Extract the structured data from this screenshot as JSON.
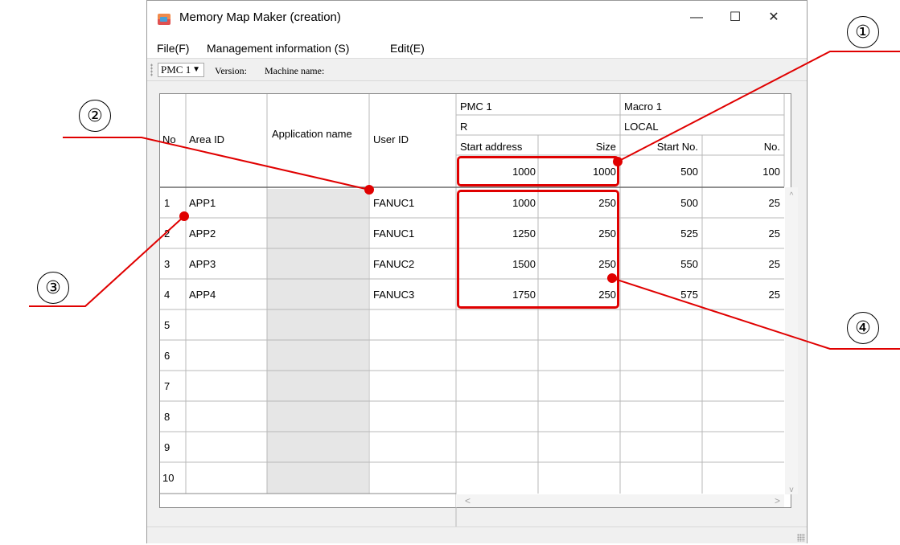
{
  "window": {
    "title": "Memory Map Maker (creation)",
    "minimize": "—",
    "maximize": "☐",
    "close": "✕"
  },
  "menu": [
    "File(F)",
    "Management information (S)",
    "Edit(E)"
  ],
  "toolbar": {
    "pmc_select": "PMC 1",
    "version_label": "Version:",
    "machine_label": "Machine name:"
  },
  "table": {
    "headers": {
      "no": "No",
      "area_id": "Area ID",
      "app_name": "Application name",
      "user_id": "User ID"
    },
    "groups": [
      {
        "name": "PMC 1",
        "sub": "R",
        "col1": "Start address",
        "col2": "Size",
        "val1": "1000",
        "val2": "1000"
      },
      {
        "name": "Macro 1",
        "sub": "LOCAL",
        "col1": "Start No.",
        "col2": "No.",
        "val1": "500",
        "val2": "100"
      }
    ],
    "rows": [
      {
        "no": "1",
        "area_id": "APP1",
        "user_id": "FANUC1",
        "pmc_start": "1000",
        "pmc_size": "250",
        "macro_start": "500",
        "macro_no": "25"
      },
      {
        "no": "2",
        "area_id": "APP2",
        "user_id": "FANUC1",
        "pmc_start": "1250",
        "pmc_size": "250",
        "macro_start": "525",
        "macro_no": "25"
      },
      {
        "no": "3",
        "area_id": "APP3",
        "user_id": "FANUC2",
        "pmc_start": "1500",
        "pmc_size": "250",
        "macro_start": "550",
        "macro_no": "25"
      },
      {
        "no": "4",
        "area_id": "APP4",
        "user_id": "FANUC3",
        "pmc_start": "1750",
        "pmc_size": "250",
        "macro_start": "575",
        "macro_no": "25"
      },
      {
        "no": "5"
      },
      {
        "no": "6"
      },
      {
        "no": "7"
      },
      {
        "no": "8"
      },
      {
        "no": "9"
      },
      {
        "no": "10"
      }
    ]
  },
  "callouts": [
    "①",
    "②",
    "③",
    "④"
  ],
  "colors": {
    "highlight": "#e00000",
    "readonly_column": "#e6e6e6"
  }
}
